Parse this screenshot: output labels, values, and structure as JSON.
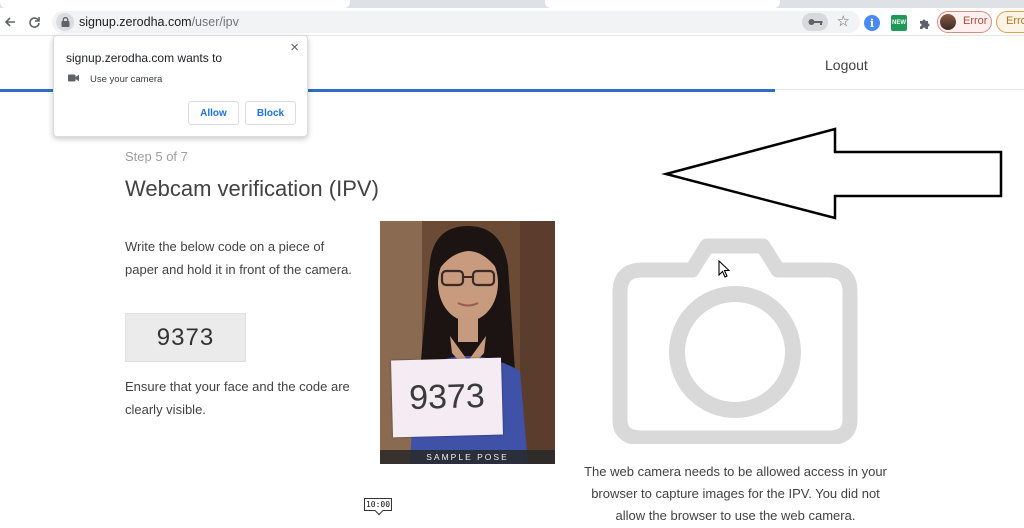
{
  "browser": {
    "url_host": "signup.zerodha.com",
    "url_path": "/user/ipv",
    "profile_label": "Error",
    "profile_label_2": "Erro"
  },
  "permission_prompt": {
    "title": "signup.zerodha.com wants to",
    "permission": "Use your camera",
    "allow_label": "Allow",
    "block_label": "Block"
  },
  "header": {
    "logout_label": "Logout",
    "progress": {
      "step": 5,
      "of": 7,
      "fraction": 0.757
    }
  },
  "main": {
    "step_label": "Step 5 of 7",
    "title": "Webcam verification (IPV)",
    "instruction": "Write the below code on a piece of paper and hold it in front of the camera.",
    "code": "9373",
    "ensure_text": "Ensure that your face and the code are clearly visible.",
    "sample_code": "9373",
    "sample_caption": "SAMPLE POSE",
    "camera_note": "The web camera needs to be allowed access in your browser to capture images for the IPV. You did not allow the browser to use the web camera."
  },
  "overlay": {
    "time_tooltip": "10:00"
  },
  "icons": {
    "back": "back-arrow-icon",
    "reload": "reload-icon",
    "lock": "lock-icon",
    "key": "key-icon",
    "star": "star-icon",
    "camera": "camera-icon"
  },
  "colors": {
    "progress": "#2f6ec2",
    "prompt_button_text": "#1a73e8",
    "camera_placeholder": "#d9d9d9"
  }
}
